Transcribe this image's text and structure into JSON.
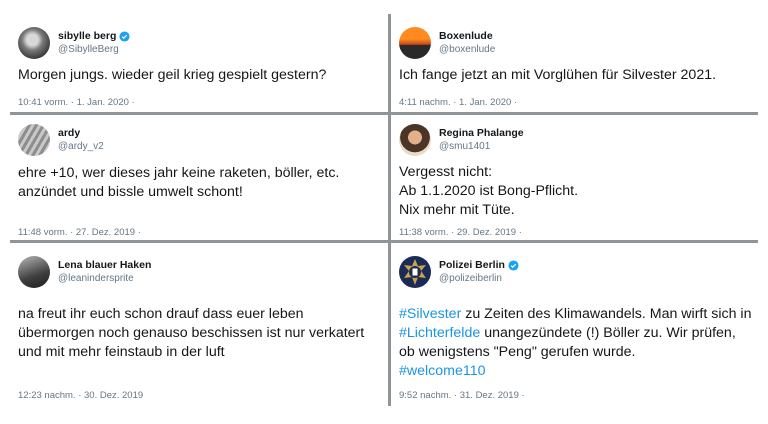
{
  "tweets": [
    {
      "name": "sibylle berg",
      "handle": "@SibylleBerg",
      "verified": true,
      "avatar_icon": "profile-photo",
      "text": "Morgen jungs. wieder geil krieg gespielt gestern?",
      "time": "10:41 vorm. · 1. Jan. 2020 ·"
    },
    {
      "name": "Boxenlude",
      "handle": "@boxenlude",
      "verified": false,
      "avatar_icon": "profile-photo",
      "text": "Ich fange jetzt an mit Vorglühen für Silvester 2021.",
      "time": "4:11 nachm. · 1. Jan. 2020 ·"
    },
    {
      "name": "ardy",
      "handle": "@ardy_v2",
      "verified": false,
      "avatar_icon": "profile-photo",
      "text": "ehre +10, wer dieses jahr keine raketen, böller, etc. anzündet und bissle umwelt schont!",
      "time": "11:48 vorm. · 27. Dez. 2019 ·"
    },
    {
      "name": "Regina Phalange",
      "handle": "@smu1401",
      "verified": false,
      "avatar_icon": "profile-photo",
      "text": "Vergesst nicht:\nAb 1.1.2020 ist Bong-Pflicht.\nNix mehr mit Tüte.",
      "time": "11:38 vorm. · 29. Dez. 2019 ·"
    },
    {
      "name": "Lena blauer Haken",
      "handle": "@leanindersprite",
      "verified": false,
      "avatar_icon": "profile-photo",
      "text": "na freut ihr euch schon drauf dass euer leben übermorgen noch genauso beschissen ist nur verkatert und mit mehr feinstaub in der luft",
      "time": "12:23 nachm. · 30. Dez. 2019"
    },
    {
      "name": "Polizei Berlin",
      "handle": "@polizeiberlin",
      "verified": true,
      "avatar_icon": "police-badge-logo",
      "text_parts": {
        "hashtag1": "#Silvester",
        "t1": " zu Zeiten des Klimawandels. Man wirft sich in ",
        "hashtag2": "#Lichterfelde",
        "t2": " unangezündete (!) Böller zu. Wir prüfen, ob wenigstens \"Peng\" gerufen wurde.",
        "hashtag3": "#welcome110"
      },
      "time": "9:52 nachm. · 31. Dez. 2019 ·"
    }
  ],
  "colors": {
    "hashtag": "#1b95e0",
    "verified": "#1da1f2",
    "divider": "#8f9499",
    "meta": "#657786"
  }
}
